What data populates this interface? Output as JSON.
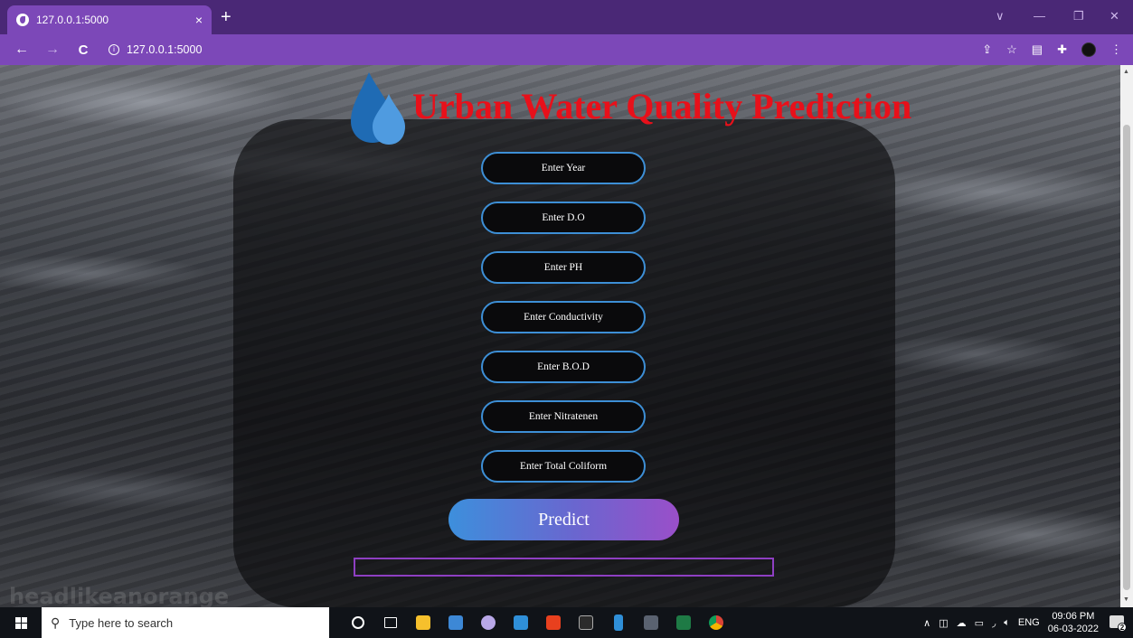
{
  "browser": {
    "tab_title": "127.0.0.1:5000",
    "tab_close": "×",
    "new_tab": "+",
    "url": "127.0.0.1:5000",
    "back": "←",
    "forward": "→",
    "reload": "C",
    "minimize_chevron": "∨",
    "minimize": "—",
    "restore": "❐",
    "close": "✕",
    "menu": "⋮",
    "accent": "#7c48b8"
  },
  "page": {
    "title": "Urban Water Quality Prediction",
    "title_color": "#e8101a",
    "watermark": "headlikeanorange",
    "fields": [
      {
        "label": "Enter Year"
      },
      {
        "label": "Enter D.O"
      },
      {
        "label": "Enter PH"
      },
      {
        "label": "Enter Conductivity"
      },
      {
        "label": "Enter B.O.D"
      },
      {
        "label": "Enter Nitratenen"
      },
      {
        "label": "Enter Total Coliform"
      }
    ],
    "predict_label": "Predict",
    "result_text": ""
  },
  "taskbar": {
    "search_placeholder": "Type here to search",
    "language": "ENG",
    "time": "09:06 PM",
    "date": "06-03-2022",
    "notification_count": "2",
    "apps": [
      "cortana-icon",
      "task-view-icon",
      "file-explorer-icon",
      "microsoft-store-icon",
      "paint-icon",
      "photos-icon",
      "office-icon",
      "terminal-icon",
      "phone-icon",
      "remote-desktop-icon",
      "excel-icon",
      "chrome-icon"
    ]
  }
}
